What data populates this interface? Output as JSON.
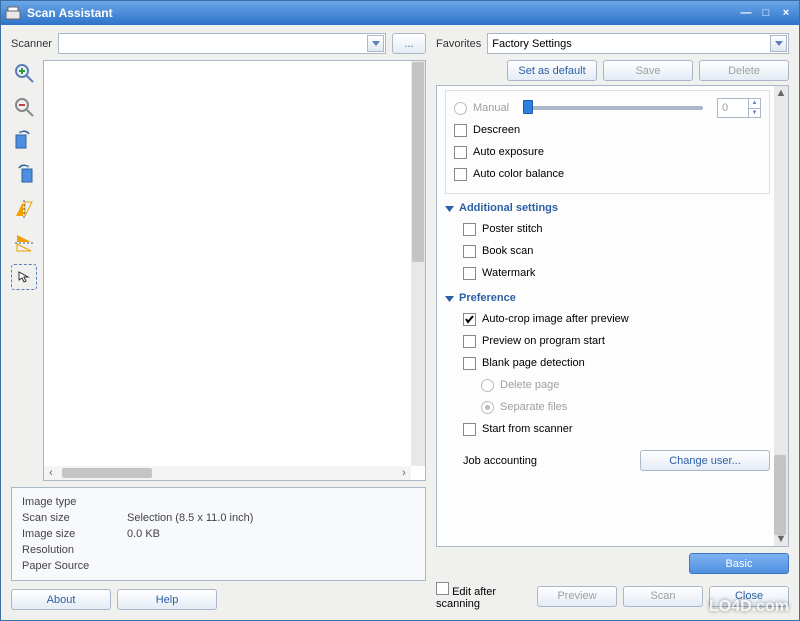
{
  "window": {
    "title": "Scan Assistant"
  },
  "left": {
    "scanner_label": "Scanner",
    "browse_label": "...",
    "info": {
      "image_type_label": "Image type",
      "image_type_value": "",
      "scan_size_label": "Scan size",
      "scan_size_value": "Selection (8.5 x 11.0 inch)",
      "image_size_label": "Image size",
      "image_size_value": "0.0 KB",
      "resolution_label": "Resolution",
      "resolution_value": "",
      "paper_source_label": "Paper Source",
      "paper_source_value": ""
    },
    "about_label": "About",
    "help_label": "Help"
  },
  "right": {
    "favorites_label": "Favorites",
    "favorites_value": "Factory Settings",
    "set_default_label": "Set as default",
    "save_label": "Save",
    "delete_label": "Delete",
    "manual_label": "Manual",
    "manual_value": "0",
    "descreen_label": "Descreen",
    "auto_exposure_label": "Auto exposure",
    "auto_color_balance_label": "Auto color balance",
    "additional_settings_label": "Additional settings",
    "poster_stitch_label": "Poster stitch",
    "book_scan_label": "Book scan",
    "watermark_label": "Watermark",
    "preference_label": "Preference",
    "auto_crop_label": "Auto-crop image after preview",
    "preview_on_start_label": "Preview on program start",
    "blank_page_label": "Blank page detection",
    "delete_page_label": "Delete page",
    "separate_files_label": "Separate files",
    "start_from_scanner_label": "Start from scanner",
    "job_accounting_label": "Job accounting",
    "change_user_label": "Change user...",
    "basic_label": "Basic",
    "edit_after_label": "Edit after scanning",
    "preview_btn_label": "Preview",
    "scan_btn_label": "Scan",
    "close_btn_label": "Close"
  },
  "watermark_site": "LO4D.com"
}
